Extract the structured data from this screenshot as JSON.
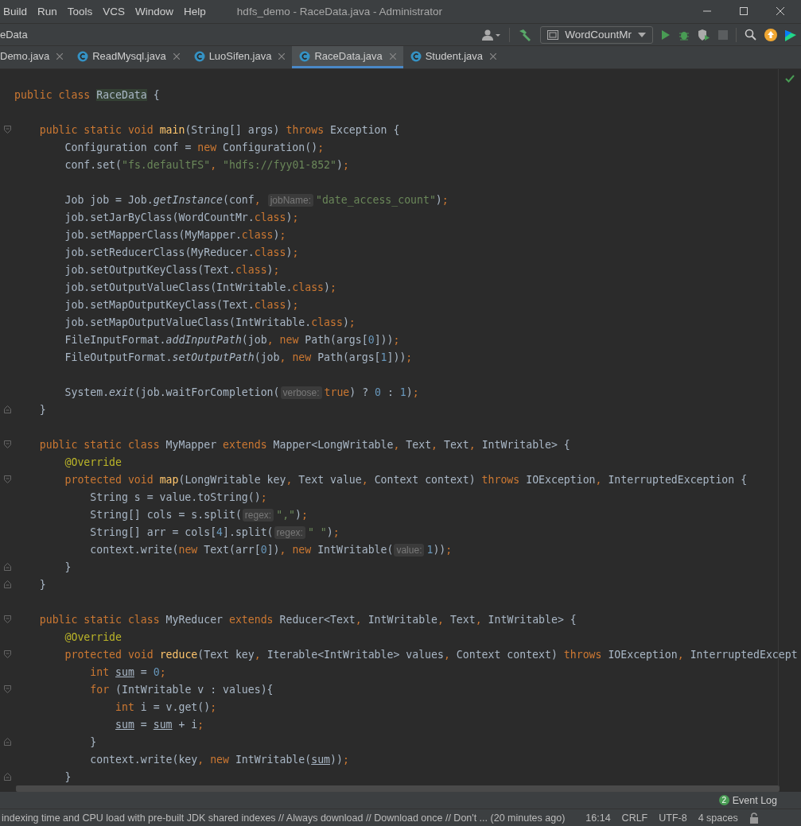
{
  "menu": [
    "Build",
    "Run",
    "Tools",
    "VCS",
    "Window",
    "Help"
  ],
  "window": {
    "title": "hdfs_demo - RaceData.java - Administrator"
  },
  "breadcrumb": "eData",
  "run_config": "WordCountMr",
  "tabs": [
    {
      "label": "Demo.java",
      "icon": false,
      "selected": false
    },
    {
      "label": "ReadMysql.java",
      "icon": true,
      "selected": false
    },
    {
      "label": "LuoSifen.java",
      "icon": true,
      "selected": false
    },
    {
      "label": "RaceData.java",
      "icon": true,
      "selected": true
    },
    {
      "label": "Student.java",
      "icon": true,
      "selected": false
    }
  ],
  "code": [
    {
      "kind": "code",
      "tokens": [
        {
          "kind": "kw",
          "text": "public class "
        },
        {
          "kind": "hl",
          "text": "RaceData"
        },
        {
          "kind": "p",
          "text": " {"
        }
      ]
    },
    {
      "kind": "blank"
    },
    {
      "kind": "code",
      "fold": {
        "kind": "start"
      },
      "tokens": [
        {
          "kind": "kw",
          "text": "    public static void "
        },
        {
          "kind": "decl",
          "text": "main"
        },
        {
          "kind": "p",
          "text": "(String[] args) "
        },
        {
          "kind": "kw",
          "text": "throws "
        },
        {
          "kind": "p",
          "text": "Exception {"
        }
      ]
    },
    {
      "kind": "code",
      "tokens": [
        {
          "kind": "p",
          "text": "        Configuration conf = "
        },
        {
          "kind": "kw",
          "text": "new "
        },
        {
          "kind": "p",
          "text": "Configuration()"
        },
        {
          "kind": "kw",
          "text": ";"
        }
      ]
    },
    {
      "kind": "code",
      "tokens": [
        {
          "kind": "p",
          "text": "        conf.set("
        },
        {
          "kind": "str",
          "text": "\"fs.defaultFS\""
        },
        {
          "kind": "kw",
          "text": ", "
        },
        {
          "kind": "str",
          "text": "\"hdfs://fyy01-852\""
        },
        {
          "kind": "p",
          "text": ")"
        },
        {
          "kind": "kw",
          "text": ";"
        }
      ]
    },
    {
      "kind": "blank"
    },
    {
      "kind": "code",
      "tokens": [
        {
          "kind": "p",
          "text": "        Job job = Job."
        },
        {
          "kind": "it",
          "text": "getInstance"
        },
        {
          "kind": "p",
          "text": "(conf"
        },
        {
          "kind": "kw",
          "text": ", "
        },
        {
          "kind": "hint",
          "text": "jobName:"
        },
        {
          "kind": "str",
          "text": "\"date_access_count\""
        },
        {
          "kind": "p",
          "text": ")"
        },
        {
          "kind": "kw",
          "text": ";"
        }
      ]
    },
    {
      "kind": "code",
      "tokens": [
        {
          "kind": "p",
          "text": "        job.setJarByClass(WordCountMr."
        },
        {
          "kind": "kw",
          "text": "class"
        },
        {
          "kind": "p",
          "text": ")"
        },
        {
          "kind": "kw",
          "text": ";"
        }
      ]
    },
    {
      "kind": "code",
      "tokens": [
        {
          "kind": "p",
          "text": "        job.setMapperClass(MyMapper."
        },
        {
          "kind": "kw",
          "text": "class"
        },
        {
          "kind": "p",
          "text": ")"
        },
        {
          "kind": "kw",
          "text": ";"
        }
      ]
    },
    {
      "kind": "code",
      "tokens": [
        {
          "kind": "p",
          "text": "        job.setReducerClass(MyReducer."
        },
        {
          "kind": "kw",
          "text": "class"
        },
        {
          "kind": "p",
          "text": ")"
        },
        {
          "kind": "kw",
          "text": ";"
        }
      ]
    },
    {
      "kind": "code",
      "tokens": [
        {
          "kind": "p",
          "text": "        job.setOutputKeyClass(Text."
        },
        {
          "kind": "kw",
          "text": "class"
        },
        {
          "kind": "p",
          "text": ")"
        },
        {
          "kind": "kw",
          "text": ";"
        }
      ]
    },
    {
      "kind": "code",
      "tokens": [
        {
          "kind": "p",
          "text": "        job.setOutputValueClass(IntWritable."
        },
        {
          "kind": "kw",
          "text": "class"
        },
        {
          "kind": "p",
          "text": ")"
        },
        {
          "kind": "kw",
          "text": ";"
        }
      ]
    },
    {
      "kind": "code",
      "tokens": [
        {
          "kind": "p",
          "text": "        job.setMapOutputKeyClass(Text."
        },
        {
          "kind": "kw",
          "text": "class"
        },
        {
          "kind": "p",
          "text": ")"
        },
        {
          "kind": "kw",
          "text": ";"
        }
      ]
    },
    {
      "kind": "code",
      "tokens": [
        {
          "kind": "p",
          "text": "        job.setMapOutputValueClass(IntWritable."
        },
        {
          "kind": "kw",
          "text": "class"
        },
        {
          "kind": "p",
          "text": ")"
        },
        {
          "kind": "kw",
          "text": ";"
        }
      ]
    },
    {
      "kind": "code",
      "tokens": [
        {
          "kind": "p",
          "text": "        FileInputFormat."
        },
        {
          "kind": "it",
          "text": "addInputPath"
        },
        {
          "kind": "p",
          "text": "(job"
        },
        {
          "kind": "kw",
          "text": ", new "
        },
        {
          "kind": "p",
          "text": "Path(args["
        },
        {
          "kind": "num",
          "text": "0"
        },
        {
          "kind": "p",
          "text": "]))"
        },
        {
          "kind": "kw",
          "text": ";"
        }
      ]
    },
    {
      "kind": "code",
      "tokens": [
        {
          "kind": "p",
          "text": "        FileOutputFormat."
        },
        {
          "kind": "it",
          "text": "setOutputPath"
        },
        {
          "kind": "p",
          "text": "(job"
        },
        {
          "kind": "kw",
          "text": ", new "
        },
        {
          "kind": "p",
          "text": "Path(args["
        },
        {
          "kind": "num",
          "text": "1"
        },
        {
          "kind": "p",
          "text": "]))"
        },
        {
          "kind": "kw",
          "text": ";"
        }
      ]
    },
    {
      "kind": "blank"
    },
    {
      "kind": "code",
      "tokens": [
        {
          "kind": "p",
          "text": "        System."
        },
        {
          "kind": "it",
          "text": "exit"
        },
        {
          "kind": "p",
          "text": "(job.waitForCompletion("
        },
        {
          "kind": "hint",
          "text": "verbose:"
        },
        {
          "kind": "kw",
          "text": "true"
        },
        {
          "kind": "p",
          "text": ") ? "
        },
        {
          "kind": "num",
          "text": "0"
        },
        {
          "kind": "p",
          "text": " : "
        },
        {
          "kind": "num",
          "text": "1"
        },
        {
          "kind": "p",
          "text": ")"
        },
        {
          "kind": "kw",
          "text": ";"
        }
      ]
    },
    {
      "kind": "code",
      "fold": {
        "kind": "end"
      },
      "tokens": [
        {
          "kind": "p",
          "text": "    }"
        }
      ]
    },
    {
      "kind": "blank"
    },
    {
      "kind": "code",
      "fold": {
        "kind": "start"
      },
      "tokens": [
        {
          "kind": "kw",
          "text": "    public static class "
        },
        {
          "kind": "p",
          "text": "MyMapper "
        },
        {
          "kind": "kw",
          "text": "extends "
        },
        {
          "kind": "p",
          "text": "Mapper<LongWritable"
        },
        {
          "kind": "kw",
          "text": ", "
        },
        {
          "kind": "p",
          "text": "Text"
        },
        {
          "kind": "kw",
          "text": ", "
        },
        {
          "kind": "p",
          "text": "Text"
        },
        {
          "kind": "kw",
          "text": ", "
        },
        {
          "kind": "p",
          "text": "IntWritable> {"
        }
      ]
    },
    {
      "kind": "code",
      "tokens": [
        {
          "kind": "ann",
          "text": "        @Override"
        }
      ]
    },
    {
      "kind": "code",
      "fold": {
        "kind": "start"
      },
      "tokens": [
        {
          "kind": "kw",
          "text": "        protected void "
        },
        {
          "kind": "decl",
          "text": "map"
        },
        {
          "kind": "p",
          "text": "(LongWritable key"
        },
        {
          "kind": "kw",
          "text": ", "
        },
        {
          "kind": "p",
          "text": "Text value"
        },
        {
          "kind": "kw",
          "text": ", "
        },
        {
          "kind": "p",
          "text": "Context context) "
        },
        {
          "kind": "kw",
          "text": "throws "
        },
        {
          "kind": "p",
          "text": "IOException"
        },
        {
          "kind": "kw",
          "text": ", "
        },
        {
          "kind": "p",
          "text": "InterruptedException {"
        }
      ]
    },
    {
      "kind": "code",
      "tokens": [
        {
          "kind": "p",
          "text": "            String s = value.toString()"
        },
        {
          "kind": "kw",
          "text": ";"
        }
      ]
    },
    {
      "kind": "code",
      "tokens": [
        {
          "kind": "p",
          "text": "            String[] cols = s.split("
        },
        {
          "kind": "hint",
          "text": "regex:"
        },
        {
          "kind": "str",
          "text": "\",\""
        },
        {
          "kind": "p",
          "text": ")"
        },
        {
          "kind": "kw",
          "text": ";"
        }
      ]
    },
    {
      "kind": "code",
      "tokens": [
        {
          "kind": "p",
          "text": "            String[] arr = cols["
        },
        {
          "kind": "num",
          "text": "4"
        },
        {
          "kind": "p",
          "text": "].split("
        },
        {
          "kind": "hint",
          "text": "regex:"
        },
        {
          "kind": "str",
          "text": "\" \""
        },
        {
          "kind": "p",
          "text": ")"
        },
        {
          "kind": "kw",
          "text": ";"
        }
      ]
    },
    {
      "kind": "code",
      "tokens": [
        {
          "kind": "p",
          "text": "            context.write("
        },
        {
          "kind": "kw",
          "text": "new "
        },
        {
          "kind": "p",
          "text": "Text(arr["
        },
        {
          "kind": "num",
          "text": "0"
        },
        {
          "kind": "p",
          "text": "])"
        },
        {
          "kind": "kw",
          "text": ", new "
        },
        {
          "kind": "p",
          "text": "IntWritable("
        },
        {
          "kind": "hint",
          "text": "value:"
        },
        {
          "kind": "num",
          "text": "1"
        },
        {
          "kind": "p",
          "text": "))"
        },
        {
          "kind": "kw",
          "text": ";"
        }
      ]
    },
    {
      "kind": "code",
      "fold": {
        "kind": "end"
      },
      "tokens": [
        {
          "kind": "p",
          "text": "        }"
        }
      ]
    },
    {
      "kind": "code",
      "fold": {
        "kind": "end"
      },
      "tokens": [
        {
          "kind": "p",
          "text": "    }"
        }
      ]
    },
    {
      "kind": "blank"
    },
    {
      "kind": "code",
      "fold": {
        "kind": "start"
      },
      "tokens": [
        {
          "kind": "kw",
          "text": "    public static class "
        },
        {
          "kind": "p",
          "text": "MyReducer "
        },
        {
          "kind": "kw",
          "text": "extends "
        },
        {
          "kind": "p",
          "text": "Reducer<Text"
        },
        {
          "kind": "kw",
          "text": ", "
        },
        {
          "kind": "p",
          "text": "IntWritable"
        },
        {
          "kind": "kw",
          "text": ", "
        },
        {
          "kind": "p",
          "text": "Text"
        },
        {
          "kind": "kw",
          "text": ", "
        },
        {
          "kind": "p",
          "text": "IntWritable> {"
        }
      ]
    },
    {
      "kind": "code",
      "tokens": [
        {
          "kind": "ann",
          "text": "        @Override"
        }
      ]
    },
    {
      "kind": "code",
      "fold": {
        "kind": "start"
      },
      "tokens": [
        {
          "kind": "kw",
          "text": "        protected void "
        },
        {
          "kind": "decl",
          "text": "reduce"
        },
        {
          "kind": "p",
          "text": "(Text key"
        },
        {
          "kind": "kw",
          "text": ", "
        },
        {
          "kind": "p",
          "text": "Iterable<IntWritable> values"
        },
        {
          "kind": "kw",
          "text": ", "
        },
        {
          "kind": "p",
          "text": "Context context) "
        },
        {
          "kind": "kw",
          "text": "throws "
        },
        {
          "kind": "p",
          "text": "IOException"
        },
        {
          "kind": "kw",
          "text": ", "
        },
        {
          "kind": "p",
          "text": "InterruptedExcept"
        }
      ]
    },
    {
      "kind": "code",
      "tokens": [
        {
          "kind": "kw",
          "text": "            int "
        },
        {
          "kind": "var",
          "text": "sum"
        },
        {
          "kind": "p",
          "text": " = "
        },
        {
          "kind": "num",
          "text": "0"
        },
        {
          "kind": "kw",
          "text": ";"
        }
      ]
    },
    {
      "kind": "code",
      "fold": {
        "kind": "start"
      },
      "tokens": [
        {
          "kind": "kw",
          "text": "            for "
        },
        {
          "kind": "p",
          "text": "(IntWritable v : values){"
        }
      ]
    },
    {
      "kind": "code",
      "tokens": [
        {
          "kind": "kw",
          "text": "                int "
        },
        {
          "kind": "p",
          "text": "i = v.get()"
        },
        {
          "kind": "kw",
          "text": ";"
        }
      ]
    },
    {
      "kind": "code",
      "tokens": [
        {
          "kind": "var",
          "text": "                sum"
        },
        {
          "kind": "p",
          "text": " = "
        },
        {
          "kind": "var",
          "text": "sum"
        },
        {
          "kind": "p",
          "text": " + i"
        },
        {
          "kind": "kw",
          "text": ";"
        }
      ]
    },
    {
      "kind": "code",
      "fold": {
        "kind": "end"
      },
      "tokens": [
        {
          "kind": "p",
          "text": "            }"
        }
      ]
    },
    {
      "kind": "code",
      "tokens": [
        {
          "kind": "p",
          "text": "            context.write(key"
        },
        {
          "kind": "kw",
          "text": ", new "
        },
        {
          "kind": "p",
          "text": "IntWritable("
        },
        {
          "kind": "var",
          "text": "sum"
        },
        {
          "kind": "p",
          "text": "))"
        },
        {
          "kind": "kw",
          "text": ";"
        }
      ]
    },
    {
      "kind": "code",
      "fold": {
        "kind": "end"
      },
      "tokens": [
        {
          "kind": "p",
          "text": "        }"
        }
      ]
    }
  ],
  "event_log": {
    "count": "2",
    "label": "Event Log"
  },
  "status": {
    "message": "indexing time and CPU load with pre-built JDK shared indexes // Always download // Download once // Don't ... (20 minutes ago)",
    "items": [
      "16:14",
      "CRLF",
      "UTF-8",
      "4 spaces"
    ]
  }
}
